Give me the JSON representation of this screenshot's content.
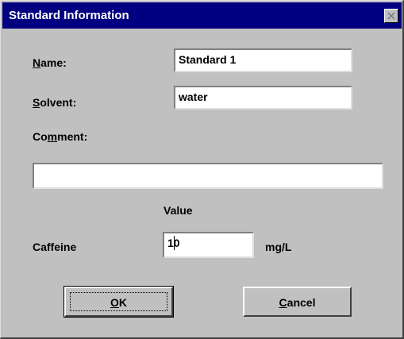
{
  "window": {
    "title": "Standard Information"
  },
  "form": {
    "name_label": {
      "pre": "",
      "key": "N",
      "post": "ame:"
    },
    "name_value": "Standard 1",
    "solvent_label": {
      "pre": "",
      "key": "S",
      "post": "olvent:"
    },
    "solvent_value": "water",
    "comment_label": {
      "pre": "Co",
      "key": "m",
      "post": "ment:"
    },
    "comment_value": "",
    "value_header": "Value",
    "caffeine_label": "Caffeine",
    "caffeine_value": "10",
    "caffeine_unit": "mg/L"
  },
  "buttons": {
    "ok": {
      "pre": "",
      "key": "O",
      "post": "K"
    },
    "cancel": {
      "pre": "",
      "key": "C",
      "post": "ancel"
    }
  },
  "icons": {
    "close": "close-icon"
  }
}
